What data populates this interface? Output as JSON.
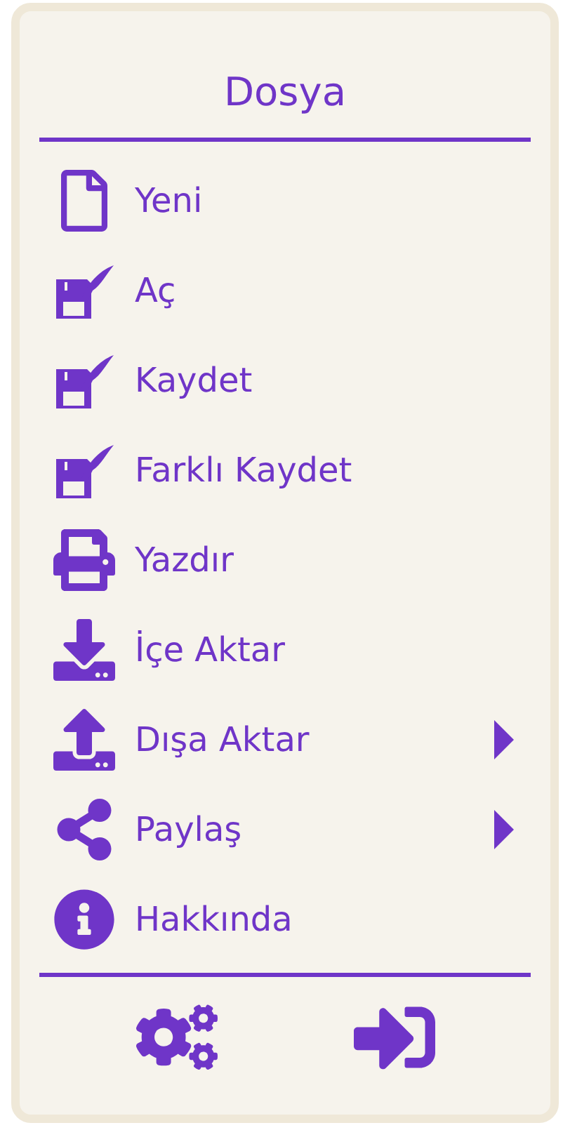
{
  "menu": {
    "title": "Dosya",
    "items": [
      {
        "label": "Yeni",
        "has_submenu": false
      },
      {
        "label": "Aç",
        "has_submenu": false
      },
      {
        "label": "Kaydet",
        "has_submenu": false
      },
      {
        "label": "Farklı Kaydet",
        "has_submenu": false
      },
      {
        "label": "Yazdır",
        "has_submenu": false
      },
      {
        "label": "İçe Aktar",
        "has_submenu": false
      },
      {
        "label": "Dışa Aktar",
        "has_submenu": true
      },
      {
        "label": "Paylaş",
        "has_submenu": true
      },
      {
        "label": "Hakkında",
        "has_submenu": false
      }
    ]
  }
}
